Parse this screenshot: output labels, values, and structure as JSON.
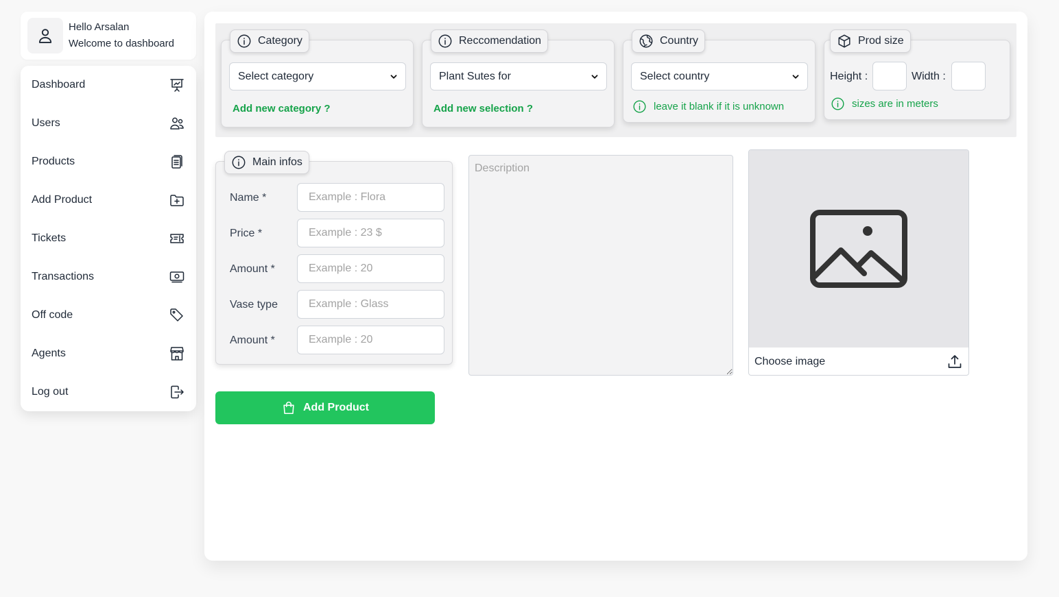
{
  "user": {
    "greeting": "Hello Arsalan",
    "subtitle": "Welcome to dashboard",
    "avatar_icon": "user-icon"
  },
  "sidebar": {
    "items": [
      {
        "label": "Dashboard",
        "icon": "presentation-chart-icon"
      },
      {
        "label": "Users",
        "icon": "users-icon"
      },
      {
        "label": "Products",
        "icon": "clipboard-icon"
      },
      {
        "label": "Add Product",
        "icon": "folder-plus-icon"
      },
      {
        "label": "Tickets",
        "icon": "ticket-icon"
      },
      {
        "label": "Transactions",
        "icon": "cash-icon"
      },
      {
        "label": "Off code",
        "icon": "tag-icon"
      },
      {
        "label": "Agents",
        "icon": "store-icon"
      },
      {
        "label": "Log out",
        "icon": "logout-icon"
      }
    ]
  },
  "category": {
    "tag": "Category",
    "select_value": "Select category",
    "link": "Add new category ?"
  },
  "recommendation": {
    "tag": "Reccomendation",
    "select_value": "Plant Sutes for",
    "link": "Add new selection ?"
  },
  "country": {
    "tag": "Country",
    "select_value": "Select country",
    "hint": "leave it blank if it is unknown"
  },
  "prod_size": {
    "tag": "Prod size",
    "height_label": "Height :",
    "width_label": "Width :",
    "hint": "sizes are in meters"
  },
  "main_infos": {
    "tag": "Main infos",
    "fields": [
      {
        "label": "Name *",
        "placeholder": "Example : Flora"
      },
      {
        "label": "Price *",
        "placeholder": "Example : 23 $"
      },
      {
        "label": "Amount *",
        "placeholder": "Example : 20"
      },
      {
        "label": "Vase type",
        "placeholder": "Example : Glass"
      },
      {
        "label": "Amount *",
        "placeholder": "Example : 20"
      }
    ]
  },
  "description": {
    "placeholder": "Description"
  },
  "image": {
    "choose_label": "Choose image",
    "placeholder_icon": "image-icon",
    "upload_icon": "upload-icon"
  },
  "actions": {
    "add_product": "Add Product"
  },
  "colors": {
    "accent_green": "#22c55e",
    "link_green": "#16a34a",
    "panel_gray": "#efeff0"
  }
}
